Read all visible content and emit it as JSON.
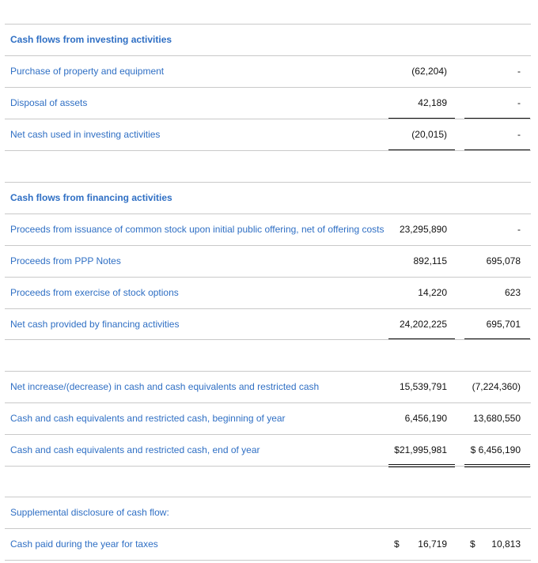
{
  "statement": {
    "investing_header": "Cash flows from investing activities",
    "investing_rows": [
      {
        "label": "Purchase of property and equipment",
        "v1": "(62,204)",
        "v2": "-"
      },
      {
        "label": "Disposal of assets",
        "v1": "42,189",
        "v2": "-"
      },
      {
        "label": "Net cash used in investing activities",
        "v1": "(20,015)",
        "v2": "-"
      }
    ],
    "financing_header": "Cash flows from financing activities",
    "financing_rows": [
      {
        "label": "Proceeds from issuance of common stock upon initial public offering, net of offering costs",
        "v1": "23,295,890",
        "v2": "-"
      },
      {
        "label": "Proceeds from PPP Notes",
        "v1": "892,115",
        "v2": "695,078"
      },
      {
        "label": "Proceeds from exercise of stock options",
        "v1": "14,220",
        "v2": "623"
      },
      {
        "label": "Net cash provided by financing activities",
        "v1": "24,202,225",
        "v2": "695,701"
      }
    ],
    "summary_rows": [
      {
        "label": "Net increase/(decrease) in cash and cash equivalents and restricted cash",
        "v1": "15,539,791",
        "v2": "(7,224,360)"
      },
      {
        "label": "Cash and cash equivalents and restricted cash, beginning of year",
        "v1": "6,456,190",
        "v2": "13,680,550"
      },
      {
        "label": "Cash and cash equivalents and restricted cash, end of year",
        "v1": "$21,995,981",
        "v2": "$ 6,456,190"
      }
    ],
    "supplemental_header": "Supplemental disclosure of cash flow:",
    "supplemental_rows": [
      {
        "label": "Cash paid during the year for taxes",
        "cur1": "$",
        "v1": "16,719",
        "cur2": "$",
        "v2": "10,813"
      }
    ]
  }
}
